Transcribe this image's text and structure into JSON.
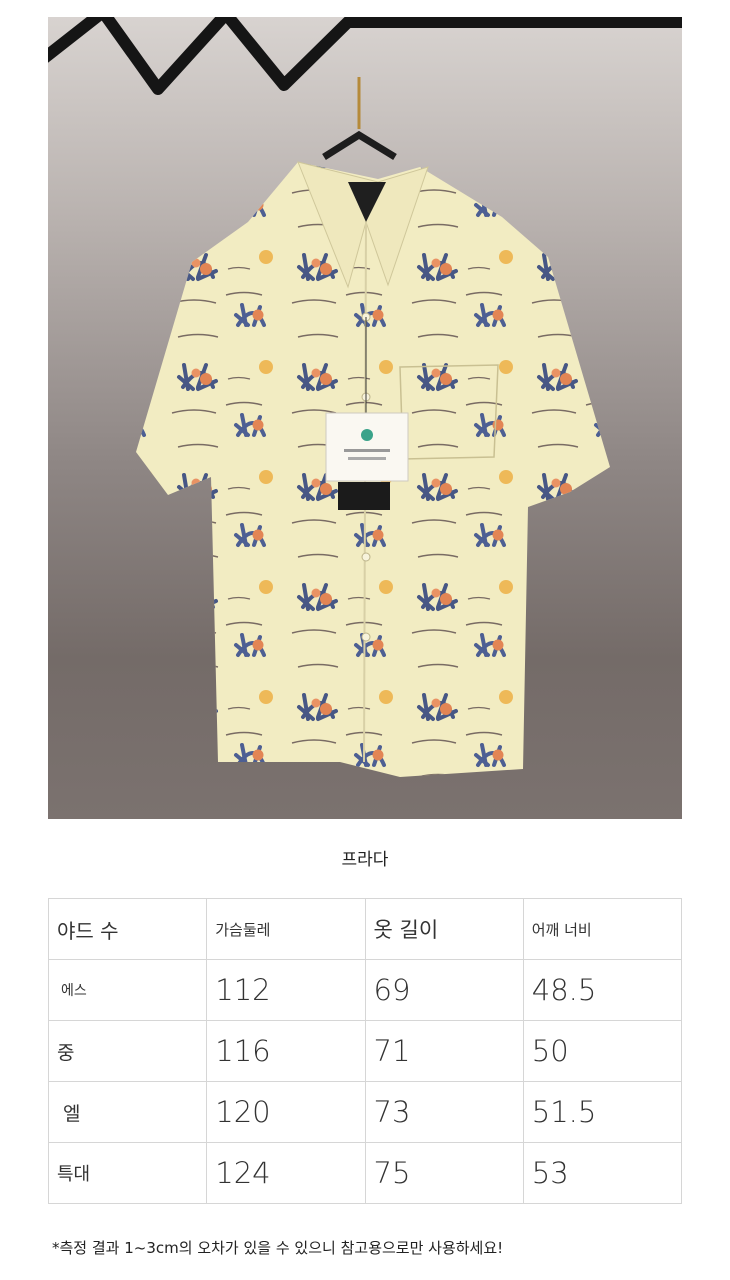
{
  "brand": "프라다",
  "table": {
    "headers": [
      "야드 수",
      "가슴둘레",
      "옷 길이",
      "어깨 너비"
    ],
    "rows": [
      [
        "에스",
        "112",
        "69",
        "48.5"
      ],
      [
        "중",
        "116",
        "71",
        "50"
      ],
      [
        "엘",
        "120",
        "73",
        "51.5"
      ],
      [
        "특대",
        "124",
        "75",
        "53"
      ]
    ]
  },
  "footnote": "*측정 결과 1~3cm의 오차가 있을 수 있으니 참고용으로만 사용하세요!",
  "colors": {
    "shirt": "#f2ecc2",
    "print_navy": "#3a4f8c",
    "print_orange": "#e07a48",
    "border": "#d6d6d6"
  }
}
